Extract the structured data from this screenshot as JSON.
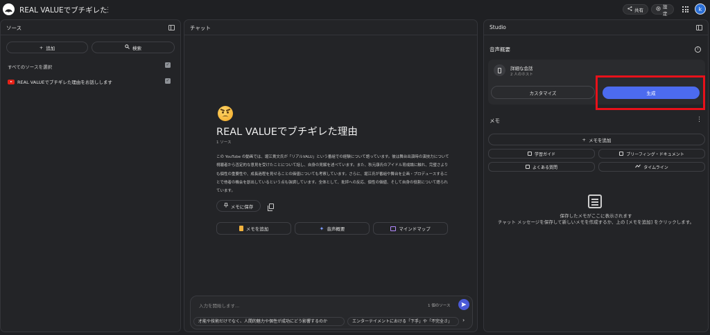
{
  "header": {
    "title": "REAL VALUEでブチギレた理由",
    "share_label": "共有",
    "settings_label": "設定",
    "avatar_initial": "k"
  },
  "sources": {
    "title": "ソース",
    "add_label": "追加",
    "search_label": "検索",
    "select_all": "すべてのソースを選択",
    "items": [
      {
        "label": "REAL VALUEでブチギレた理由をお話しします",
        "checked": true
      }
    ]
  },
  "chat": {
    "title": "チャット",
    "notebook_title": "REAL VALUEでブチギレた理由",
    "source_count": "1 ソース",
    "summary": "この YouTube の動画では、堀江貴文氏が「リアルVALU」という番組での経験について語っています。彼は舞台出演時の演技力について視聴者から否定的な意見を受けたことについて話し、自身の見解を述べています。また、秋元康氏のアイドル育成論に触れ、完璧さよりも個性の重要性や、成長過程を見せることの価値についても考察しています。さらに、堀江氏が番組や舞台を企画・プロデュースすることで他者の機会を創出しているという点も強調しています。全体として、批評への反応、個性の価値、そして自身の役割について語られています。",
    "save_note_label": "メモに保存",
    "actions": [
      "メモを追加",
      "音声概要",
      "マインドマップ"
    ],
    "input_placeholder": "入力を開始します...",
    "input_source_count": "1 個のソース",
    "suggestions": [
      "才能や技術だけでなく、人間的魅力や個性が成功にどう影響するのか",
      "エンターテイメントにおける「下手」や「不完全さ」"
    ]
  },
  "studio": {
    "title": "Studio",
    "audio_overview_title": "音声概要",
    "audio_card_title": "詳細な会話",
    "audio_card_sub": "2 人のホスト",
    "customize_label": "カスタマイズ",
    "generate_label": "生成",
    "memo_title": "メモ",
    "add_memo_label": "メモを追加",
    "memo_buttons": [
      "学習ガイド",
      "ブリーフィング・ドキュメント",
      "よくある質問",
      "タイムライン"
    ],
    "empty_line1": "保存したメモがここに表示されます",
    "empty_line2": "チャット メッセージを保存して新しいメモを作成するか、上の [メモを追加] をクリックします。"
  },
  "colors": {
    "background": "#1f2023",
    "panel": "#232427",
    "accent": "#4c6bef",
    "highlight": "#e8111a"
  }
}
